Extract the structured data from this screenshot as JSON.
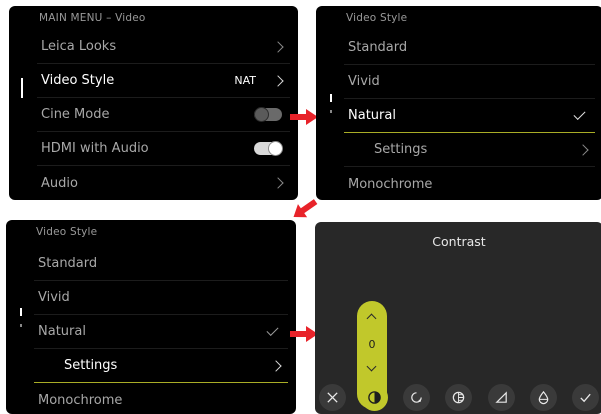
{
  "screen1": {
    "title": "MAIN MENU – Video",
    "items": [
      {
        "label": "Leica Looks",
        "value": "",
        "control": "chevron"
      },
      {
        "label": "Video Style",
        "value": "NAT",
        "control": "chevron"
      },
      {
        "label": "Cine Mode",
        "value": "",
        "control": "toggle-off"
      },
      {
        "label": "HDMI with Audio",
        "value": "",
        "control": "toggle-on"
      },
      {
        "label": "Audio",
        "value": "",
        "control": "chevron"
      }
    ]
  },
  "screen2": {
    "title": "Video Style",
    "items": [
      {
        "label": "Standard"
      },
      {
        "label": "Vivid"
      },
      {
        "label": "Natural"
      },
      {
        "label": "Settings"
      },
      {
        "label": "Monochrome"
      }
    ]
  },
  "screen3": {
    "title": "Video Style",
    "items": [
      {
        "label": "Standard"
      },
      {
        "label": "Vivid"
      },
      {
        "label": "Natural"
      },
      {
        "label": "Settings"
      },
      {
        "label": "Monochrome"
      }
    ]
  },
  "screen4": {
    "title": "Contrast",
    "value": "0",
    "icons": [
      "close-icon",
      "contrast-icon",
      "saturation-icon",
      "highlights-icon",
      "sharpness-icon",
      "tint-icon",
      "confirm-icon"
    ]
  },
  "colors": {
    "accent": "#c1c82b",
    "arrow": "#e8232a",
    "screen_bg": "#000000",
    "contrast_bg": "#282828"
  }
}
